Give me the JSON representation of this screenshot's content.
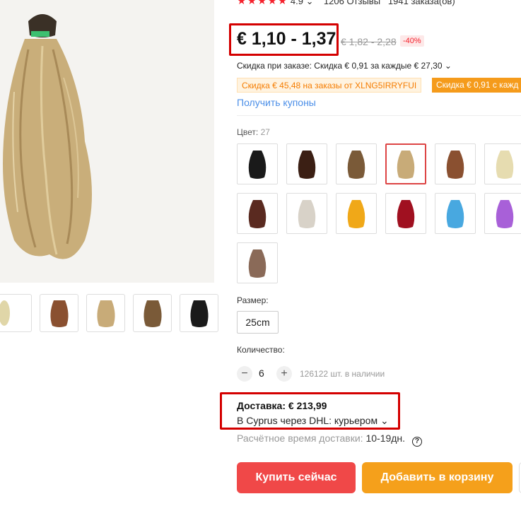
{
  "rating": {
    "stars": "★★★★★",
    "score": "4.9",
    "reviews": "1206 Отзывы",
    "orders": "1941 заказа(ов)"
  },
  "price": {
    "current": "€ 1,10 - 1,37",
    "old": "€ 1,82 - 2,28",
    "discount": "-40%"
  },
  "order_discount": "Скидка при заказе: Скидка € 0,91 за каждые € 27,30",
  "coupons": {
    "first": "Скидка € 45,48 на заказы от XLNG5IRRYFUI",
    "second": "Скидка € 0,91 с кажд",
    "get_label": "Получить купоны"
  },
  "color": {
    "label": "Цвет:",
    "count": "27"
  },
  "swatch_colors": [
    "#1a1a1a",
    "#3b1f14",
    "#7a5a38",
    "#c8ab78",
    "#8a5030",
    "#e6dcb0",
    "#5a2a20",
    "#d8d2c8",
    "#f0a818",
    "#a01020",
    "#48a8e0",
    "#a860d8",
    "#8a6a58"
  ],
  "size": {
    "label": "Размер:",
    "value": "25cm"
  },
  "quantity": {
    "label": "Количество:",
    "minus": "−",
    "plus": "+",
    "value": "6",
    "stock": "126122 шт. в наличии"
  },
  "shipping": {
    "title": "Доставка: € 213,99",
    "via": "В Cyprus через DHL: курьером",
    "eta_label": "Расчётное время доставки:",
    "eta_value": "10-19дн.",
    "help": "?"
  },
  "buttons": {
    "buy": "Купить сейчас",
    "cart": "Добавить в корзину"
  }
}
